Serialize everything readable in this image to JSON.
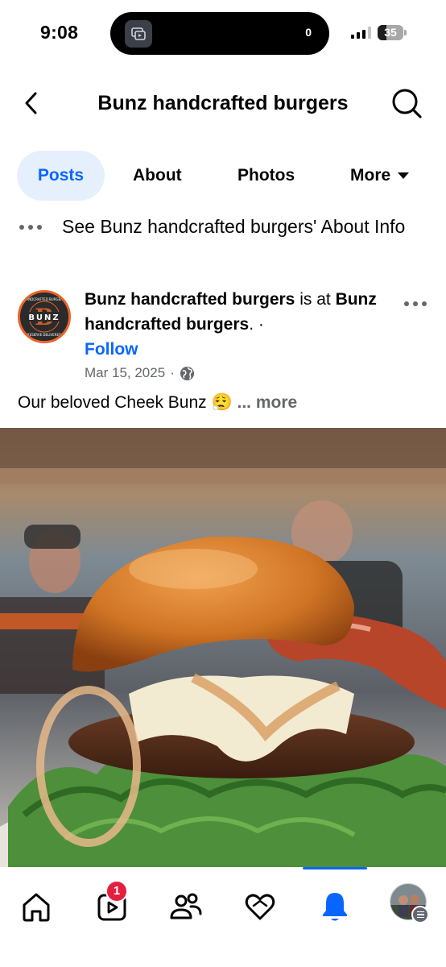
{
  "status_bar": {
    "time": "9:08",
    "island_count": "0",
    "battery_percent": "35",
    "battery_level": 0.35,
    "signal_bars_active": 3
  },
  "header": {
    "title": "Bunz handcrafted burgers",
    "back_icon": "chevron-left-icon",
    "search_icon": "search-icon"
  },
  "tabs": [
    {
      "label": "Posts",
      "active": true
    },
    {
      "label": "About",
      "active": false
    },
    {
      "label": "Photos",
      "active": false
    },
    {
      "label": "More",
      "active": false
    }
  ],
  "about_info": {
    "text": "See Bunz handcrafted burgers' About Info"
  },
  "post": {
    "author": "Bunz handcrafted burgers",
    "connector": " is at ",
    "location": "Bunz handcrafted burgers",
    "location_suffix": ". ·",
    "follow_label": "Follow",
    "date": "Mar 15, 2025",
    "separator": "·",
    "privacy_icon": "globe-icon",
    "avatar": {
      "logo_word": "BUNZ",
      "logo_letter": "B",
      "ring_text_top": "HANDCRAFTED BURGERS",
      "ring_text_bottom": "RESERVE DELIVERED"
    },
    "caption": "Our beloved Cheek Bunz",
    "caption_emoji": "😮‍💨",
    "caption_more": "... more"
  },
  "bottom_nav": {
    "items": [
      {
        "name": "home-icon",
        "active": false
      },
      {
        "name": "video-icon",
        "active": false,
        "badge": "1"
      },
      {
        "name": "friends-icon",
        "active": false
      },
      {
        "name": "dating-heart-icon",
        "active": false
      },
      {
        "name": "notifications-bell-icon",
        "active": true
      },
      {
        "name": "profile-menu-icon",
        "active": false
      }
    ]
  },
  "colors": {
    "accent": "#0866ff",
    "tab_active_bg": "#e6f0fd",
    "badge": "#e41e3f",
    "secondary_text": "#65676b"
  }
}
